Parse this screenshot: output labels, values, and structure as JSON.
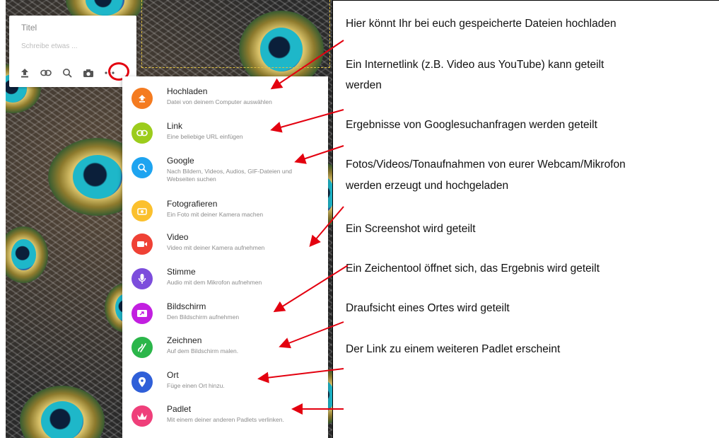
{
  "card": {
    "title_placeholder": "Titel",
    "body_placeholder": "Schreibe etwas ...",
    "tools": [
      {
        "icon": "upload-icon"
      },
      {
        "icon": "link-icon"
      },
      {
        "icon": "search-icon"
      },
      {
        "icon": "camera-icon"
      },
      {
        "icon": "more-icon"
      }
    ]
  },
  "menu": {
    "items": [
      {
        "label": "Hochladen",
        "desc": "Datei von deinem Computer auswählen",
        "icon": "upload-icon",
        "color": "#f47b20"
      },
      {
        "label": "Link",
        "desc": "Eine beliebige URL einfügen",
        "icon": "link-icon",
        "color": "#9ccc1c"
      },
      {
        "label": "Google",
        "desc": "Nach Bildern, Videos, Audios, GIF-Dateien und Webseiten suchen",
        "icon": "search-icon",
        "color": "#1ea4f0"
      },
      {
        "label": "Fotografieren",
        "desc": "Ein Foto mit deiner Kamera machen",
        "icon": "camera-icon",
        "color": "#fbc02d"
      },
      {
        "label": "Video",
        "desc": "Video mit deiner Kamera aufnehmen",
        "icon": "video-icon",
        "color": "#ef4135"
      },
      {
        "label": "Stimme",
        "desc": "Audio mit dem Mikrofon aufnehmen",
        "icon": "microphone-icon",
        "color": "#7c4ddc"
      },
      {
        "label": "Bildschirm",
        "desc": "Den Bildschirm aufnehmen",
        "icon": "screen-icon",
        "color": "#c21fe0"
      },
      {
        "label": "Zeichnen",
        "desc": "Auf dem Bildschirm malen.",
        "icon": "draw-icon",
        "color": "#2bb64a"
      },
      {
        "label": "Ort",
        "desc": "Füge einen Ort hinzu.",
        "icon": "location-pin-icon",
        "color": "#2f5fd8"
      },
      {
        "label": "Padlet",
        "desc": "Mit einem deiner anderen Padlets verlinken.",
        "icon": "padlet-icon",
        "color": "#ef3f7a"
      }
    ]
  },
  "annotations": [
    "Hier könnt Ihr bei euch gespeicherte Dateien hochladen",
    "Ein Internetlink (z.B. Video aus YouTube) kann geteilt",
    "werden",
    "Ergebnisse von Googlesuchanfragen werden geteilt",
    "Fotos/Videos/Tonaufnahmen von eurer Webcam/Mikrofon",
    "werden erzeugt und hochgeladen",
    "Ein Screenshot wird geteilt",
    "Ein Zeichentool öffnet sich, das Ergebnis wird geteilt",
    "Draufsicht eines Ortes wird geteilt",
    "Der Link zu einem weiteren Padlet erscheint"
  ],
  "colors": {
    "arrow": "#e3000f",
    "highlight_ring": "#e3000f"
  }
}
